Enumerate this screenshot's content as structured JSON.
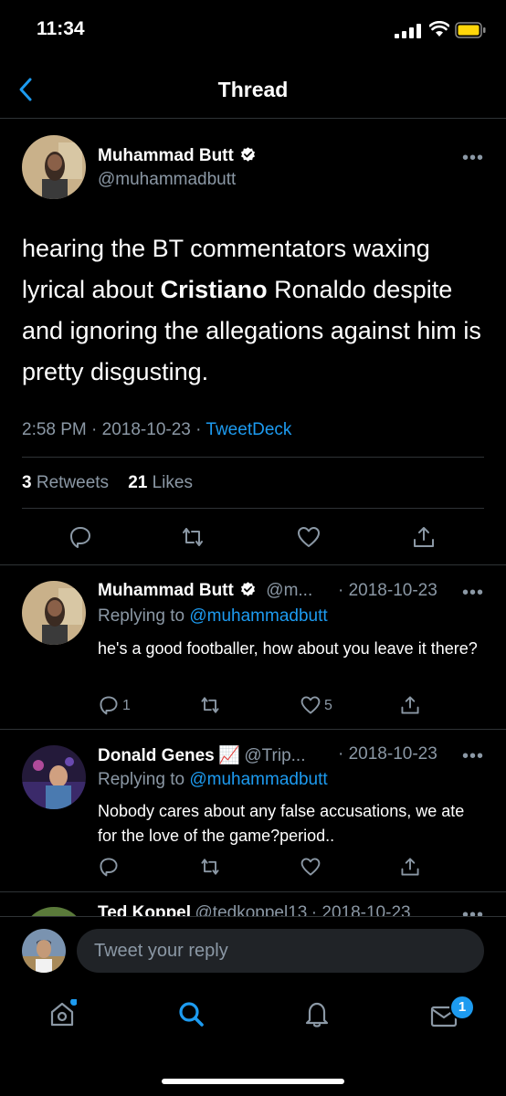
{
  "status_bar": {
    "time": "11:34"
  },
  "nav": {
    "title": "Thread"
  },
  "main_tweet": {
    "author_name": "Muhammad Butt",
    "handle": "@muhammadbutt",
    "text_before": "hearing the BT commentators waxing lyrical about ",
    "text_bold": "Cristiano",
    "text_after": " Ronaldo despite and ignoring the allegations against him is pretty disgusting.",
    "time": "2:58 PM",
    "separator": "·",
    "date": "2018-10-23",
    "source": "TweetDeck",
    "retweets_count": "3",
    "retweets_label": "Retweets",
    "likes_count": "21",
    "likes_label": "Likes",
    "more": "•••"
  },
  "replies": [
    {
      "author_name": "Muhammad Butt",
      "handle": "@m...",
      "date": "· 2018-10-23",
      "replying_label": "Replying to",
      "replying_handle": "@muhammadbutt",
      "text": "he's a good footballer, how about you leave it there?",
      "reply_count": "1",
      "like_count": "5",
      "more": "•••"
    },
    {
      "author_name": "Donald Genes",
      "emoji": "📈",
      "handle": "@Trip...",
      "date": "· 2018-10-23",
      "replying_label": "Replying to",
      "replying_handle": "@muhammadbutt",
      "text": "Nobody cares about any false accusations, we ate for the love of the game?period..",
      "more": "•••"
    },
    {
      "author_name": "Ted Koppel",
      "handle": "@tedkoppel13",
      "date": "· 2018-10-23",
      "more": "•••"
    }
  ],
  "compose": {
    "placeholder": "Tweet your reply"
  },
  "tab_bar": {
    "notifications_badge": "1"
  },
  "colors": {
    "accent": "#1d9bf0",
    "background": "#000000",
    "secondary_text": "#8b98a5"
  }
}
